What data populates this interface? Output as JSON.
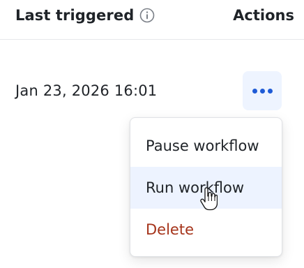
{
  "header": {
    "last_triggered_label": "Last triggered",
    "actions_label": "Actions",
    "info_icon": "info-icon"
  },
  "row": {
    "last_triggered": "Jan 23, 2026 16:01",
    "more_button_icon": "more-horizontal-icon"
  },
  "menu": {
    "items": [
      {
        "label": "Pause workflow"
      },
      {
        "label": "Run workflow"
      },
      {
        "label": "Delete"
      }
    ]
  },
  "colors": {
    "accent": "#1f5bd6",
    "button_bg": "#eef4ff",
    "hover_bg": "#edf3ff",
    "danger": "#a5331a"
  }
}
